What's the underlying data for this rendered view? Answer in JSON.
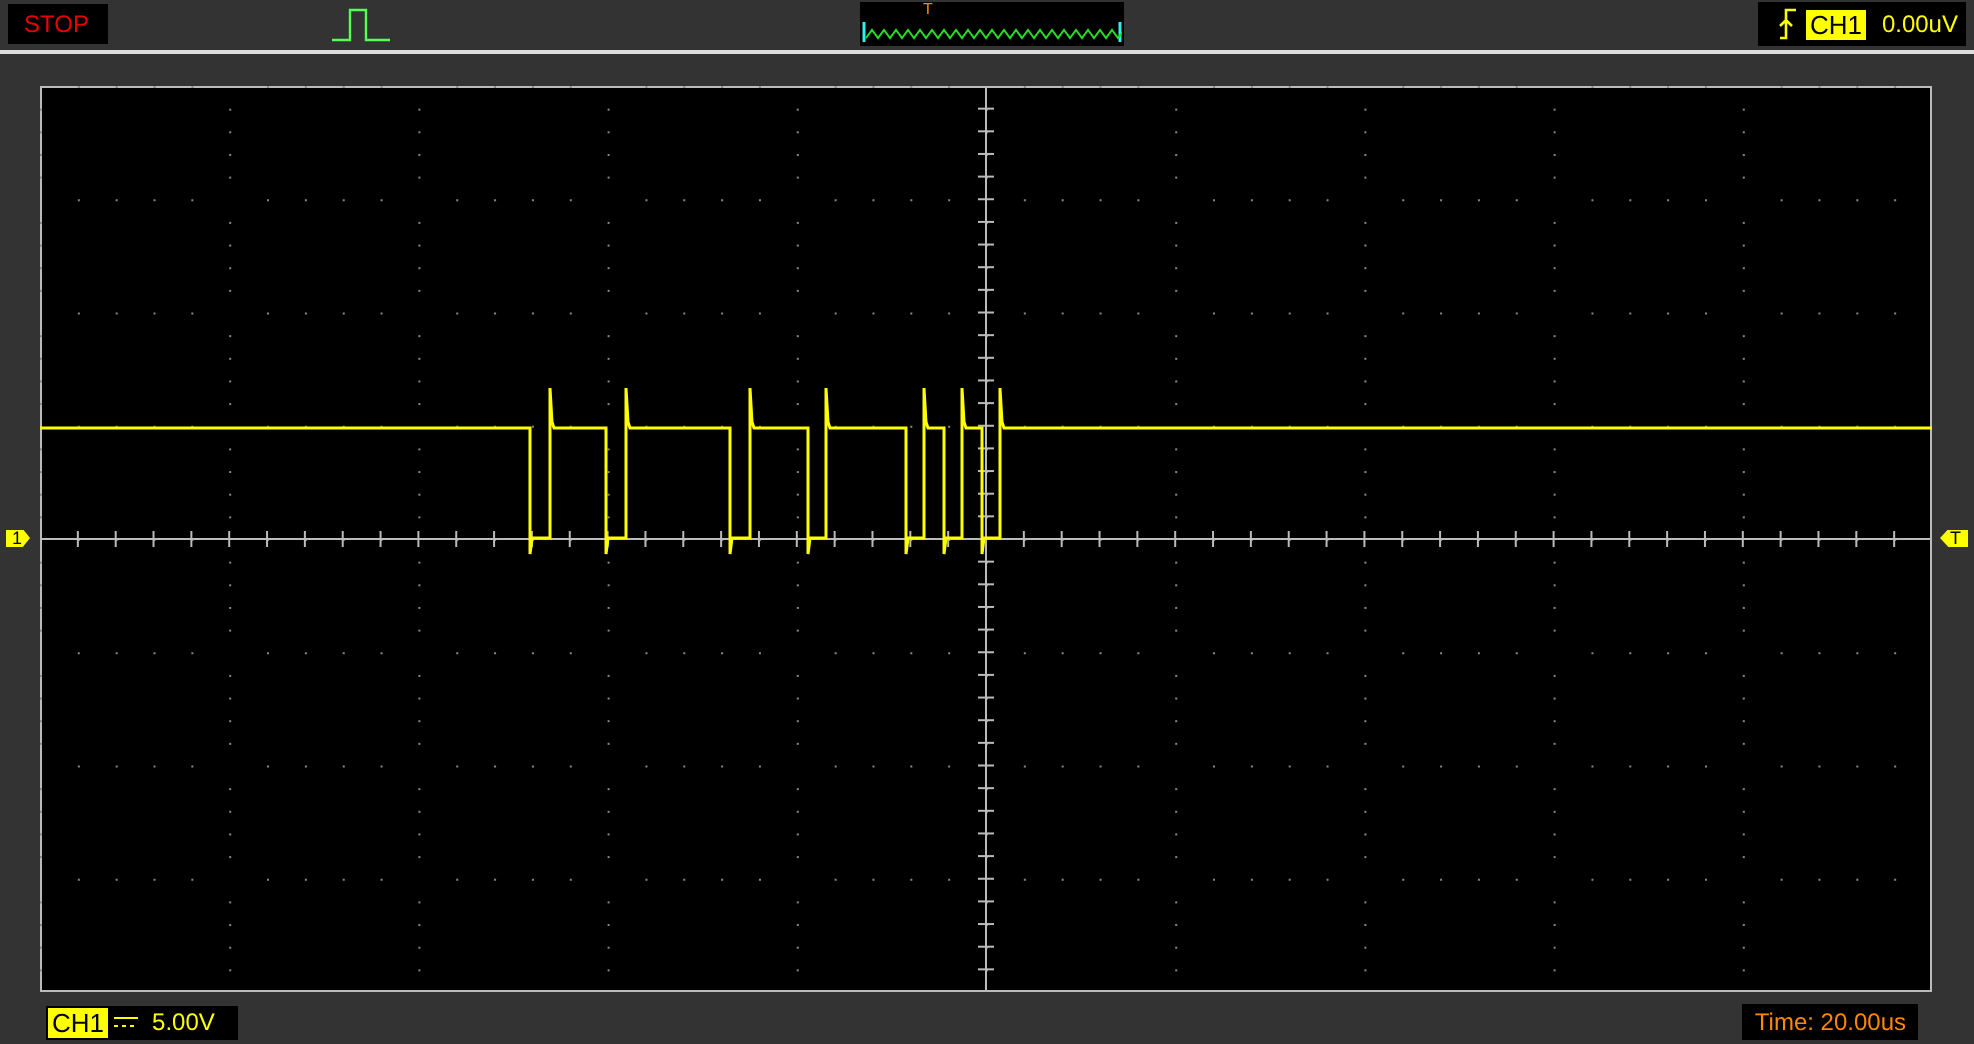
{
  "status": {
    "label": "STOP"
  },
  "memory_bar": {
    "trigger_marker": "T"
  },
  "trigger": {
    "channel": "CH1",
    "level": "0.00uV"
  },
  "screen": {
    "channel_marker": "1",
    "trigger_level_marker": "T"
  },
  "footer": {
    "channel": "CH1",
    "volts_div": "5.00V",
    "timebase": "Time: 20.00us"
  }
}
